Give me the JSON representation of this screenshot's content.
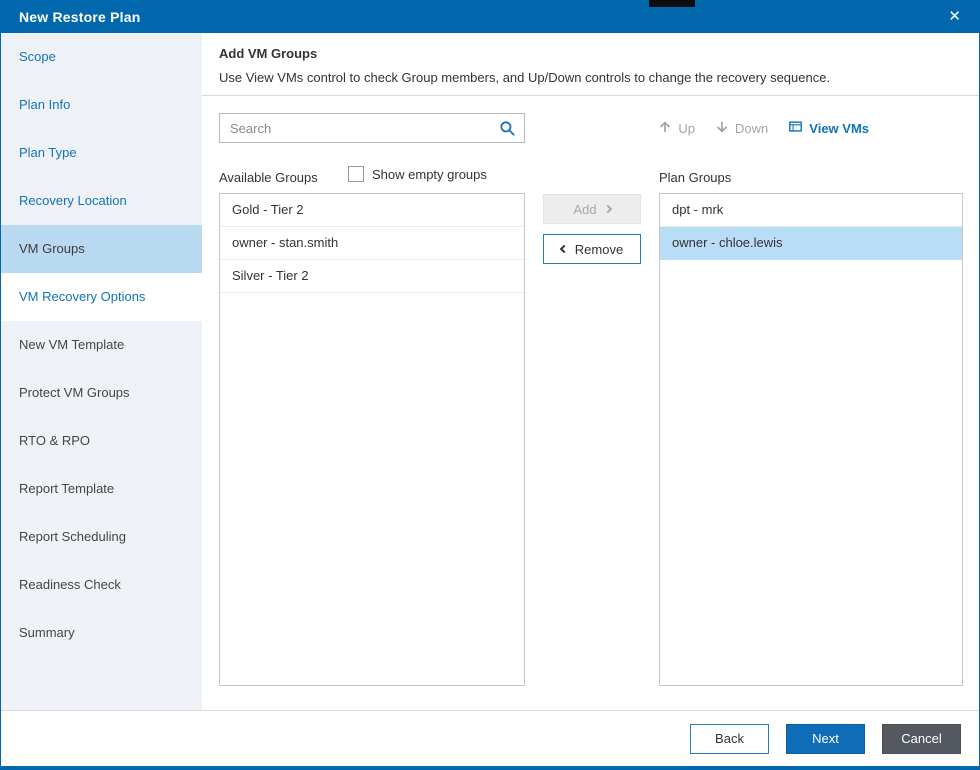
{
  "window": {
    "title": "New Restore Plan",
    "close_glyph": "✕"
  },
  "sidebar": {
    "items": [
      {
        "label": "Scope",
        "state": "completed"
      },
      {
        "label": "Plan Info",
        "state": "completed"
      },
      {
        "label": "Plan Type",
        "state": "completed"
      },
      {
        "label": "Recovery Location",
        "state": "completed"
      },
      {
        "label": "VM Groups",
        "state": "current"
      },
      {
        "label": "VM Recovery Options",
        "state": "next"
      },
      {
        "label": "New VM Template",
        "state": "upcoming"
      },
      {
        "label": "Protect VM Groups",
        "state": "upcoming"
      },
      {
        "label": "RTO & RPO",
        "state": "upcoming"
      },
      {
        "label": "Report Template",
        "state": "upcoming"
      },
      {
        "label": "Report Scheduling",
        "state": "upcoming"
      },
      {
        "label": "Readiness Check",
        "state": "upcoming"
      },
      {
        "label": "Summary",
        "state": "upcoming"
      }
    ]
  },
  "main": {
    "header": {
      "title": "Add VM Groups",
      "subtitle": "Use View VMs control to check Group members, and Up/Down controls to change the recovery sequence."
    },
    "search": {
      "placeholder": "Search",
      "value": ""
    },
    "toolbar": {
      "up": "Up",
      "down": "Down",
      "view_vms": "View VMs"
    },
    "available": {
      "label": "Available Groups",
      "show_empty_label": "Show empty groups",
      "show_empty_checked": false,
      "items": [
        "Gold - Tier 2",
        "owner - stan.smith",
        "Silver - Tier 2"
      ]
    },
    "transfer": {
      "add": "Add",
      "remove": "Remove"
    },
    "plan": {
      "label": "Plan Groups",
      "items": [
        {
          "label": "dpt - mrk",
          "selected": false
        },
        {
          "label": "owner - chloe.lewis",
          "selected": true
        }
      ]
    }
  },
  "footer": {
    "back": "Back",
    "next": "Next",
    "cancel": "Cancel"
  },
  "colors": {
    "titlebar": "#0168ae",
    "accent_link": "#1273b8",
    "sidebar_active_bg": "#b9d9f1",
    "list_selected_bg": "#b9dcf7",
    "primary_button": "#0f6cb6",
    "cancel_button": "#54595f"
  }
}
